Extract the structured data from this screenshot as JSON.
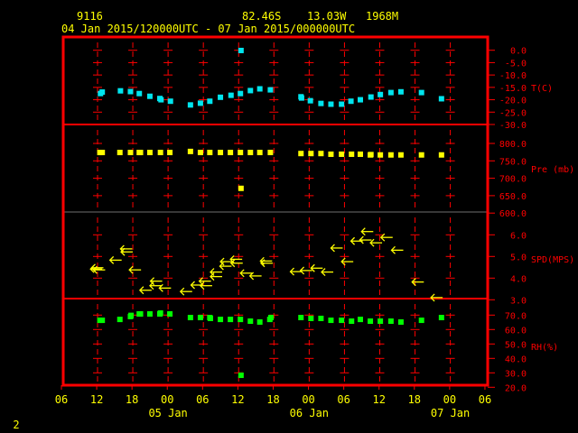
{
  "header": {
    "station": "9116",
    "lat": "82.46S",
    "lon": "13.03W",
    "elev": "1968M",
    "range": "04 Jan 2015/120000UTC - 07 Jan 2015/000000UTC"
  },
  "page_number": "2",
  "colors": {
    "frame": "#ff0000",
    "temp": "#00e5ee",
    "pres": "#ffff00",
    "wind": "#ffff00",
    "rh": "#00ff00",
    "text": "#ffff00"
  },
  "chart_data": {
    "type": "scatter",
    "title": "9116 82.46S 13.03W 1968M",
    "subtitle": "04 Jan 2015/120000UTC - 07 Jan 2015/000000UTC",
    "x_unit": "hours since 04 Jan 2015 12UTC",
    "xlim": [
      -6,
      66
    ],
    "x_ticks": [
      "06",
      "12",
      "18",
      "00",
      "06",
      "12",
      "18",
      "00",
      "06",
      "12",
      "18",
      "00",
      "06"
    ],
    "x_dates": [
      {
        "label": "05 Jan",
        "h": 12
      },
      {
        "label": "06 Jan",
        "h": 36
      },
      {
        "label": "07 Jan",
        "h": 60
      }
    ],
    "panels": [
      {
        "id": "temp",
        "label": "T(C)",
        "ylim": [
          -30,
          0
        ],
        "ticks": [
          "0.0",
          "-5.0",
          "-10.0",
          "-15.0",
          "-20.0",
          "-25.0",
          "-30.0"
        ],
        "tick_values": [
          0,
          -5,
          -10,
          -15,
          -20,
          -25,
          -30
        ],
        "points": [
          [
            0.5,
            -17.5
          ],
          [
            0.8,
            -16.9
          ],
          [
            3.9,
            -16.4
          ],
          [
            5.6,
            -16.7
          ],
          [
            7.1,
            -17.5
          ],
          [
            8.9,
            -18.6
          ],
          [
            10.6,
            -19.5
          ],
          [
            10.8,
            -20.0
          ],
          [
            12.4,
            -20.6
          ],
          [
            15.8,
            -22.1
          ],
          [
            17.5,
            -21.4
          ],
          [
            19.1,
            -20.6
          ],
          [
            20.9,
            -19.0
          ],
          [
            22.7,
            -18.2
          ],
          [
            24.3,
            -17.5
          ],
          [
            24.4,
            -0.1
          ],
          [
            26.0,
            -16.3
          ],
          [
            27.6,
            -15.6
          ],
          [
            29.4,
            -16.0
          ],
          [
            34.6,
            -18.8
          ],
          [
            34.7,
            -19.3
          ],
          [
            36.2,
            -20.4
          ],
          [
            38.0,
            -21.5
          ],
          [
            39.7,
            -21.8
          ],
          [
            41.5,
            -21.8
          ],
          [
            43.1,
            -20.6
          ],
          [
            44.7,
            -20.0
          ],
          [
            46.5,
            -18.9
          ],
          [
            48.1,
            -17.9
          ],
          [
            49.9,
            -17.1
          ],
          [
            51.6,
            -16.8
          ],
          [
            55.1,
            -17.1
          ],
          [
            58.5,
            -19.6
          ]
        ]
      },
      {
        "id": "pres",
        "label": "Pre (mb)",
        "ylim": [
          600,
          850
        ],
        "ticks": [
          "800.0",
          "750.0",
          "700.0",
          "650.0",
          "600.0"
        ],
        "tick_values": [
          800,
          750,
          700,
          650,
          600
        ],
        "points": [
          [
            0.4,
            774
          ],
          [
            0.8,
            774
          ],
          [
            3.8,
            774
          ],
          [
            5.6,
            774
          ],
          [
            7.1,
            774
          ],
          [
            7.3,
            774
          ],
          [
            8.9,
            774
          ],
          [
            10.7,
            774
          ],
          [
            12.3,
            774
          ],
          [
            15.8,
            777
          ],
          [
            17.5,
            774
          ],
          [
            19.1,
            774
          ],
          [
            20.9,
            774
          ],
          [
            22.6,
            774
          ],
          [
            24.3,
            774
          ],
          [
            24.4,
            671
          ],
          [
            26.0,
            774
          ],
          [
            27.6,
            774
          ],
          [
            29.4,
            774
          ],
          [
            34.6,
            771
          ],
          [
            36.3,
            771
          ],
          [
            38.0,
            771
          ],
          [
            39.7,
            769
          ],
          [
            41.5,
            769
          ],
          [
            43.2,
            769
          ],
          [
            44.7,
            769
          ],
          [
            46.4,
            767
          ],
          [
            46.5,
            768
          ],
          [
            48.1,
            767
          ],
          [
            49.9,
            767
          ],
          [
            51.6,
            767
          ],
          [
            55.1,
            767
          ],
          [
            58.5,
            767
          ]
        ]
      },
      {
        "id": "wind",
        "label": "SPD(MPS)",
        "ylim": [
          3,
          7
        ],
        "ticks": [
          "6.0",
          "5.0",
          "4.0",
          "3.0"
        ],
        "tick_values": [
          6,
          5,
          4,
          3
        ],
        "points": [
          [
            -1.2,
            4.42
          ],
          [
            -1.0,
            4.48
          ],
          [
            -0.7,
            4.38
          ],
          [
            2.1,
            4.83
          ],
          [
            3.9,
            5.35
          ],
          [
            4.0,
            5.21
          ],
          [
            5.4,
            4.38
          ],
          [
            7.2,
            3.44
          ],
          [
            9.0,
            3.86
          ],
          [
            8.9,
            3.65
          ],
          [
            10.5,
            3.54
          ],
          [
            14.1,
            3.38
          ],
          [
            15.9,
            3.68
          ],
          [
            17.3,
            3.86
          ],
          [
            17.5,
            3.65
          ],
          [
            19.2,
            4.28
          ],
          [
            19.2,
            4.07
          ],
          [
            20.9,
            4.76
          ],
          [
            20.8,
            4.55
          ],
          [
            22.6,
            4.87
          ],
          [
            22.7,
            4.69
          ],
          [
            24.3,
            4.23
          ],
          [
            25.9,
            4.1
          ],
          [
            27.7,
            4.79
          ],
          [
            27.8,
            4.69
          ],
          [
            32.8,
            4.3
          ],
          [
            34.5,
            4.35
          ],
          [
            36.3,
            4.46
          ],
          [
            38.1,
            4.28
          ],
          [
            39.7,
            5.39
          ],
          [
            41.5,
            4.76
          ],
          [
            43.1,
            5.71
          ],
          [
            44.6,
            5.76
          ],
          [
            44.9,
            6.15
          ],
          [
            46.4,
            5.63
          ],
          [
            48.2,
            5.88
          ],
          [
            50.0,
            5.29
          ],
          [
            53.5,
            3.82
          ],
          [
            56.7,
            3.1
          ]
        ],
        "direction": "easterly (arrows point west)"
      },
      {
        "id": "rh",
        "label": "RH(%)",
        "ylim": [
          20,
          80
        ],
        "ticks": [
          "70.0",
          "60.0",
          "50.0",
          "40.0",
          "30.0",
          "20.0"
        ],
        "tick_values": [
          70,
          60,
          50,
          40,
          30,
          20
        ],
        "points": [
          [
            0.4,
            66.4
          ],
          [
            0.8,
            66.4
          ],
          [
            3.8,
            67.0
          ],
          [
            5.6,
            69.0
          ],
          [
            5.7,
            69.8
          ],
          [
            7.1,
            70.8
          ],
          [
            7.3,
            70.8
          ],
          [
            8.9,
            70.8
          ],
          [
            10.6,
            70.8
          ],
          [
            10.7,
            71.4
          ],
          [
            12.3,
            70.8
          ],
          [
            15.8,
            68.3
          ],
          [
            17.5,
            68.3
          ],
          [
            19.1,
            68.3
          ],
          [
            19.2,
            67.7
          ],
          [
            20.9,
            67.0
          ],
          [
            22.6,
            67.0
          ],
          [
            24.3,
            67.0
          ],
          [
            24.4,
            28.3
          ],
          [
            26.0,
            65.8
          ],
          [
            27.6,
            65.2
          ],
          [
            29.3,
            67.0
          ],
          [
            29.5,
            68.3
          ],
          [
            34.6,
            68.3
          ],
          [
            36.3,
            67.7
          ],
          [
            38.0,
            67.7
          ],
          [
            39.7,
            66.4
          ],
          [
            41.5,
            66.4
          ],
          [
            43.2,
            65.8
          ],
          [
            44.7,
            67.0
          ],
          [
            46.4,
            65.8
          ],
          [
            48.1,
            65.8
          ],
          [
            49.9,
            65.8
          ],
          [
            51.6,
            65.2
          ],
          [
            55.1,
            66.4
          ],
          [
            58.5,
            68.3
          ]
        ]
      }
    ]
  }
}
